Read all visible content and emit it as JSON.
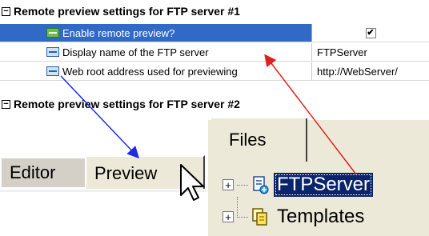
{
  "grid": {
    "section1": {
      "title": "Remote preview settings for FTP server #1",
      "toggle": "⊟"
    },
    "rows": [
      {
        "label": "Enable remote preview?",
        "value": "✔"
      },
      {
        "label": "Display name of the FTP server",
        "value": "FTPServer"
      },
      {
        "label": "Web root address used for previewing",
        "value": "http://WebServer/"
      }
    ],
    "section2": {
      "title": "Remote preview settings for FTP server #2",
      "toggle": "⊟"
    }
  },
  "tabs": {
    "editor": "Editor",
    "preview": "Preview"
  },
  "files": {
    "tab_label": "Files",
    "tree": [
      {
        "label": "FTPServer",
        "expander": "+"
      },
      {
        "label": "Templates",
        "expander": "+"
      }
    ]
  },
  "colors": {
    "selection": "#3169c6",
    "tree_selection": "#0a246a",
    "arrow_blue": "#1f2be0",
    "arrow_red": "#e02020"
  }
}
